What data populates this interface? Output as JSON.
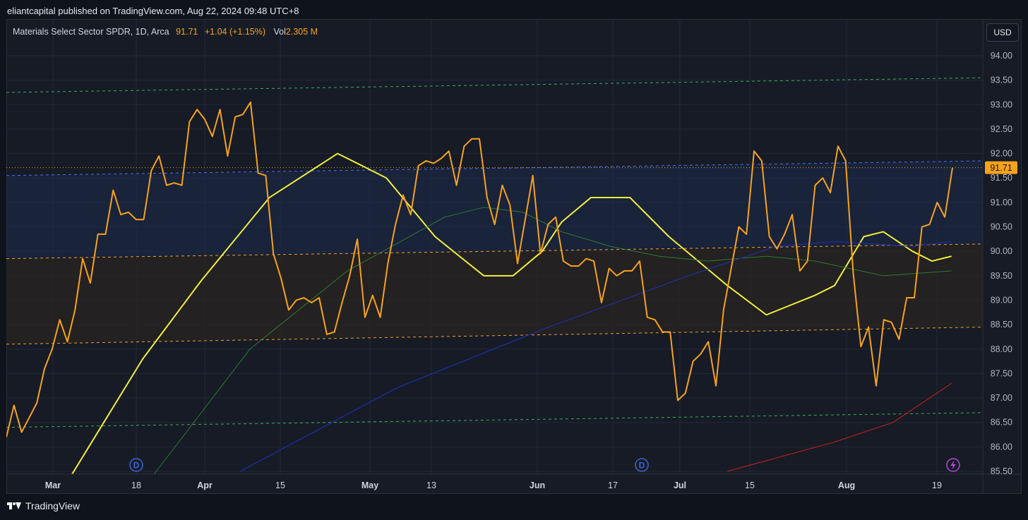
{
  "header": {
    "text": "eliantcapital published on TradingView.com, Aug 22, 2024 09:48 UTC+8"
  },
  "legend": {
    "symbol": "Materials Select Sector SPDR, 1D, Arca",
    "price": "91.71",
    "change": "+1.04 (+1.15%)",
    "vol_label": "Vol",
    "vol_value": "2.305 M"
  },
  "currency_button": "USD",
  "footer": {
    "brand": "TradingView"
  },
  "colors": {
    "price": "#f7a21b",
    "sma20": "#f2ee3a",
    "sma50": "#2f7a32",
    "sma100": "#1f2fa6",
    "sma200": "#b01f1f",
    "channel_outer": "#3fae55",
    "channel_mid": "#4a6ff0",
    "channel_band": "#f0a030",
    "event_icon": "#3d67d8",
    "flash_icon": "#b04ad8"
  },
  "chart_data": {
    "type": "line",
    "title": "",
    "xlabel": "",
    "ylabel": "",
    "ylim": [
      85.4,
      94.4
    ],
    "yticks": [
      "94.00",
      "93.50",
      "93.00",
      "92.50",
      "92.00",
      "91.50",
      "91.00",
      "90.50",
      "90.00",
      "89.50",
      "89.00",
      "88.50",
      "88.00",
      "87.50",
      "87.00",
      "86.50",
      "86.00",
      "85.50"
    ],
    "xticks": [
      "Mar",
      "18",
      "Apr",
      "15",
      "May",
      "13",
      "Jun",
      "17",
      "Jul",
      "15",
      "Aug",
      "19"
    ],
    "last_price_label": "91.71",
    "price_series": [
      86.2,
      86.85,
      86.3,
      86.6,
      86.9,
      87.6,
      88.0,
      88.6,
      88.15,
      88.8,
      89.85,
      89.35,
      90.35,
      90.35,
      91.25,
      90.75,
      90.8,
      90.65,
      90.65,
      91.65,
      91.95,
      91.35,
      91.4,
      91.35,
      92.65,
      92.9,
      92.7,
      92.35,
      92.9,
      91.95,
      92.75,
      92.8,
      93.05,
      91.6,
      91.55,
      89.95,
      89.45,
      88.8,
      89.0,
      89.05,
      88.95,
      89.05,
      88.3,
      88.35,
      88.95,
      89.5,
      90.25,
      88.65,
      89.1,
      88.65,
      89.75,
      90.55,
      91.15,
      90.75,
      91.75,
      91.85,
      91.8,
      91.9,
      92.05,
      91.35,
      92.15,
      92.3,
      92.3,
      91.1,
      90.55,
      91.35,
      90.95,
      89.75,
      90.65,
      91.55,
      89.95,
      90.55,
      90.7,
      89.8,
      89.7,
      89.7,
      89.85,
      89.8,
      88.95,
      89.65,
      89.5,
      89.6,
      89.6,
      89.8,
      88.65,
      88.6,
      88.35,
      88.35,
      86.95,
      87.1,
      87.75,
      87.9,
      88.15,
      87.25,
      88.8,
      89.65,
      90.5,
      90.35,
      92.05,
      91.85,
      90.3,
      90.05,
      90.35,
      90.75,
      89.6,
      89.8,
      91.35,
      91.5,
      91.2,
      92.15,
      91.85,
      89.55,
      88.05,
      88.45,
      87.25,
      88.6,
      88.55,
      88.2,
      89.05,
      89.05,
      90.5,
      90.55,
      91.0,
      90.7,
      91.71
    ],
    "series": [
      {
        "x": [
          0.06,
          0.14,
          0.2,
          0.27,
          0.34,
          0.39,
          0.44,
          0.49,
          0.52,
          0.55,
          0.57,
          0.6,
          0.64,
          0.68,
          0.71,
          0.74,
          0.78,
          0.83,
          0.85,
          0.88,
          0.9,
          0.93,
          0.95,
          0.97
        ],
        "values": [
          85.2,
          87.8,
          89.4,
          91.1,
          92.0,
          91.5,
          90.3,
          89.5,
          89.5,
          90.0,
          90.6,
          91.1,
          91.1,
          90.3,
          89.8,
          89.3,
          88.7,
          89.1,
          89.3,
          90.3,
          90.4,
          90.0,
          89.8,
          89.9
        ]
      },
      {
        "x": [
          0.15,
          0.25,
          0.35,
          0.45,
          0.49,
          0.53,
          0.57,
          0.62,
          0.67,
          0.72,
          0.78,
          0.83,
          0.9,
          0.97
        ],
        "values": [
          85.4,
          88.0,
          89.6,
          90.7,
          90.9,
          90.8,
          90.4,
          90.1,
          89.9,
          89.8,
          89.9,
          89.8,
          89.5,
          89.6
        ]
      },
      {
        "x": [
          0.24,
          0.4,
          0.55,
          0.7,
          0.79,
          0.85,
          0.93,
          0.97
        ],
        "values": [
          85.5,
          87.2,
          88.4,
          89.5,
          90.1,
          90.2,
          90.1,
          90.2
        ]
      },
      {
        "x": [
          0.74,
          0.85,
          0.91,
          0.97
        ],
        "values": [
          85.5,
          86.1,
          86.5,
          87.3
        ]
      }
    ],
    "channel_lines": [
      {
        "role": "outer",
        "y": [
          93.25,
          93.55
        ]
      },
      {
        "role": "mid",
        "y": [
          91.55,
          91.85
        ]
      },
      {
        "role": "band",
        "y": [
          89.85,
          90.15
        ]
      },
      {
        "role": "band",
        "y": [
          88.1,
          88.45
        ]
      },
      {
        "role": "outer",
        "y": [
          86.4,
          86.7
        ]
      }
    ],
    "reference_lines": [
      91.71
    ],
    "event_markers": [
      "D",
      "D"
    ],
    "grid": true
  }
}
